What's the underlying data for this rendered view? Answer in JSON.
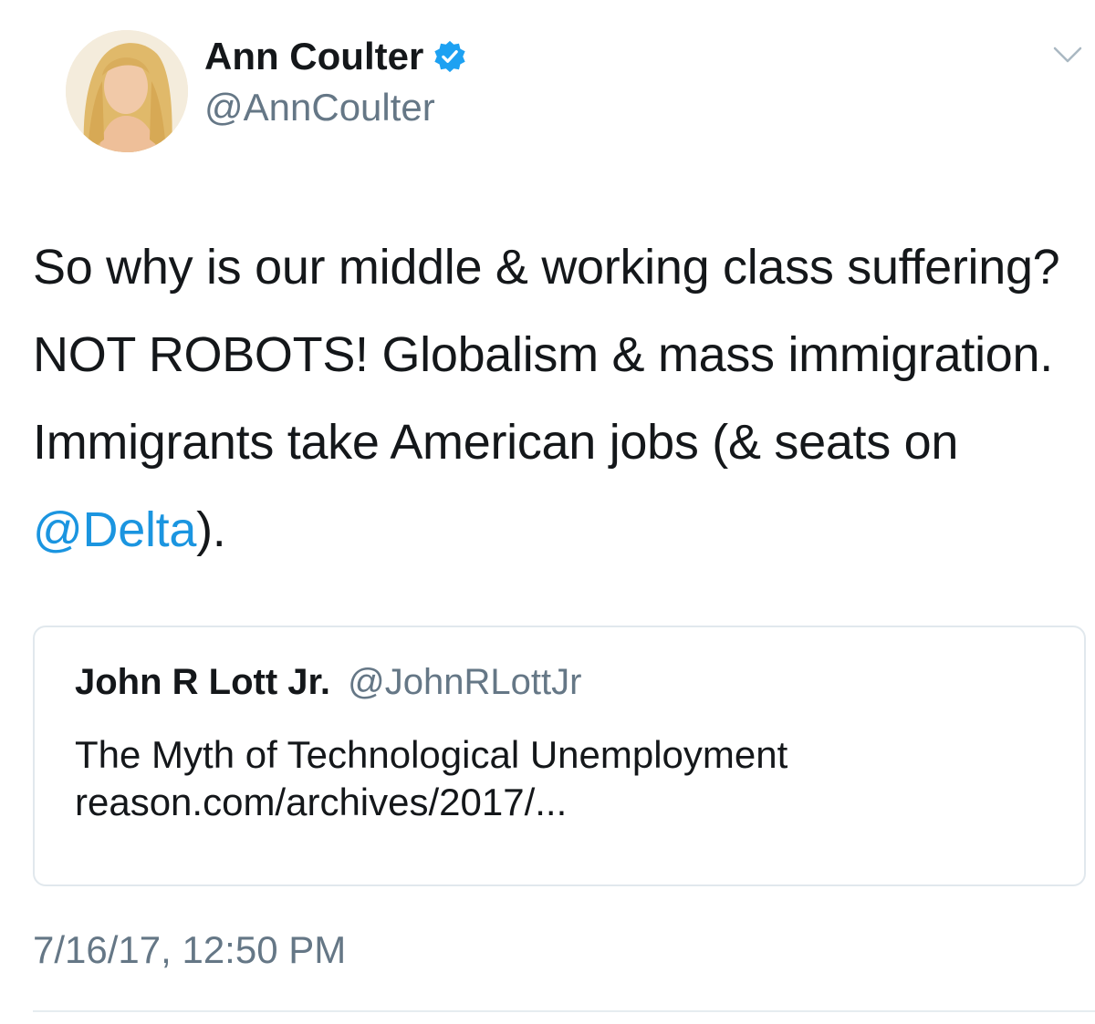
{
  "author": {
    "name": "Ann Coulter",
    "handle": "@AnnCoulter",
    "verified": true
  },
  "tweet": {
    "text_before_mention": "So why is our middle & working class suffering? NOT ROBOTS! Globalism & mass immigration. Immigrants take American jobs (& seats on ",
    "mention": "@Delta",
    "text_after_mention": ")."
  },
  "quoted_tweet": {
    "name": "John R Lott Jr.",
    "handle": "@JohnRLottJr",
    "title": "The Myth of Technological Unemployment",
    "link": "reason.com/archives/2017/..."
  },
  "timestamp": "7/16/17, 12:50 PM",
  "icons": {
    "verified": "verified-badge-icon",
    "menu": "chevron-down-icon"
  },
  "colors": {
    "link": "#1b95e0",
    "secondary_text": "#657786",
    "primary_text": "#14171a",
    "border": "#e1e8ed"
  }
}
